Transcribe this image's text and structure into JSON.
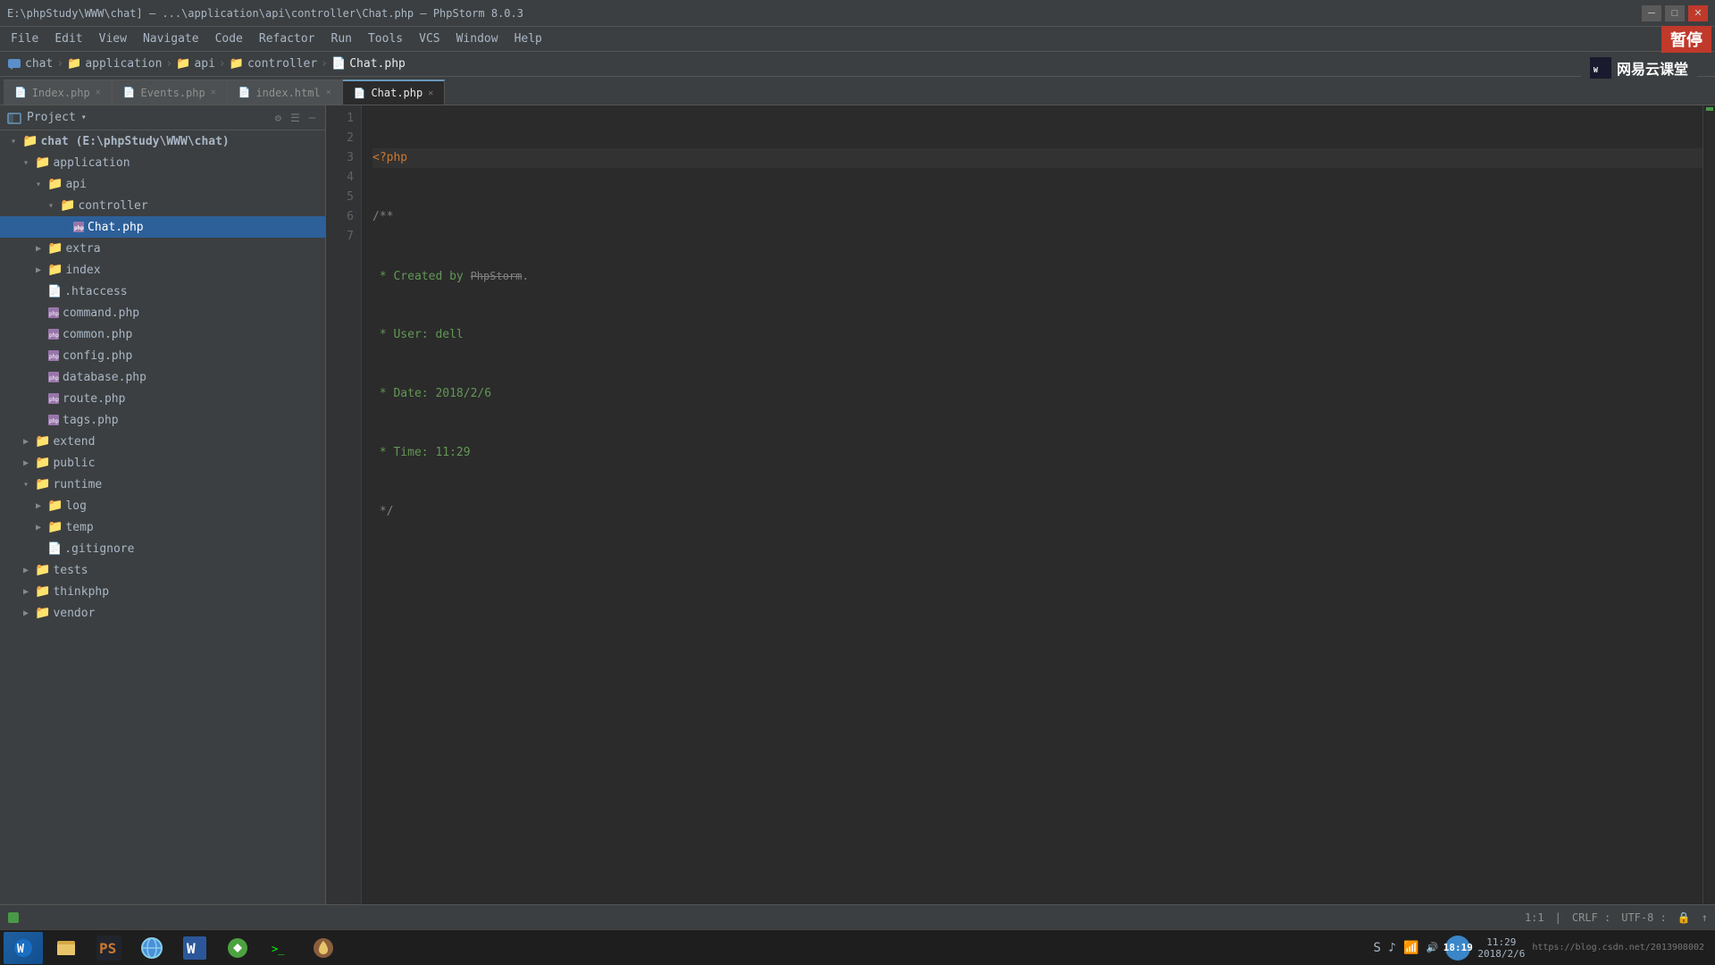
{
  "window": {
    "title": "E:\\phpStudy\\WWW\\chat] – ...\\application\\api\\controller\\Chat.php – PhpStorm 8.0.3",
    "minimize_label": "─",
    "maximize_label": "□",
    "close_label": "✕"
  },
  "menu": {
    "items": [
      "File",
      "Edit",
      "View",
      "Navigate",
      "Code",
      "Refactor",
      "Run",
      "Tools",
      "VCS",
      "Window",
      "Help"
    ]
  },
  "breadcrumb": {
    "items": [
      "chat",
      "application",
      "api",
      "controller",
      "Chat.php"
    ]
  },
  "watermark": {
    "text": "网易云课堂"
  },
  "tabs": [
    {
      "label": "Index.php",
      "active": false
    },
    {
      "label": "Events.php",
      "active": false
    },
    {
      "label": "index.html",
      "active": false
    },
    {
      "label": "Chat.php",
      "active": true
    }
  ],
  "project": {
    "label": "Project",
    "dropdown_icon": "▾"
  },
  "tree": [
    {
      "indent": 1,
      "type": "folder",
      "open": true,
      "label": "chat (E:\\phpStudy\\WWW\\chat)",
      "bold": true
    },
    {
      "indent": 2,
      "type": "folder",
      "open": true,
      "label": "application"
    },
    {
      "indent": 3,
      "type": "folder",
      "open": true,
      "label": "api"
    },
    {
      "indent": 4,
      "type": "folder",
      "open": true,
      "label": "controller"
    },
    {
      "indent": 5,
      "type": "file-php",
      "open": false,
      "label": "Chat.php",
      "selected": true
    },
    {
      "indent": 3,
      "type": "folder",
      "open": false,
      "label": "extra"
    },
    {
      "indent": 3,
      "type": "folder",
      "open": false,
      "label": "index"
    },
    {
      "indent": 3,
      "type": "file",
      "open": false,
      "label": ".htaccess"
    },
    {
      "indent": 3,
      "type": "file-php",
      "open": false,
      "label": "command.php"
    },
    {
      "indent": 3,
      "type": "file-php",
      "open": false,
      "label": "common.php"
    },
    {
      "indent": 3,
      "type": "file-php",
      "open": false,
      "label": "config.php"
    },
    {
      "indent": 3,
      "type": "file-php",
      "open": false,
      "label": "database.php"
    },
    {
      "indent": 3,
      "type": "file-php",
      "open": false,
      "label": "route.php"
    },
    {
      "indent": 3,
      "type": "file-php",
      "open": false,
      "label": "tags.php"
    },
    {
      "indent": 2,
      "type": "folder",
      "open": false,
      "label": "extend"
    },
    {
      "indent": 2,
      "type": "folder",
      "open": false,
      "label": "public"
    },
    {
      "indent": 2,
      "type": "folder",
      "open": true,
      "label": "runtime"
    },
    {
      "indent": 3,
      "type": "folder",
      "open": false,
      "label": "log"
    },
    {
      "indent": 3,
      "type": "folder",
      "open": false,
      "label": "temp"
    },
    {
      "indent": 3,
      "type": "file",
      "open": false,
      "label": ".gitignore"
    },
    {
      "indent": 2,
      "type": "folder",
      "open": false,
      "label": "tests"
    },
    {
      "indent": 2,
      "type": "folder",
      "open": false,
      "label": "thinkphp"
    },
    {
      "indent": 2,
      "type": "folder",
      "open": false,
      "label": "vendor"
    }
  ],
  "code": {
    "lines": [
      {
        "num": 1,
        "content": "<?php",
        "type": "php-tag"
      },
      {
        "num": 2,
        "content": "/**",
        "type": "comment"
      },
      {
        "num": 3,
        "content": " * Created by PhpStorm.",
        "type": "comment-text"
      },
      {
        "num": 4,
        "content": " * User: dell",
        "type": "comment-text"
      },
      {
        "num": 5,
        "content": " * Date: 2018/2/6",
        "type": "comment-text"
      },
      {
        "num": 6,
        "content": " * Time: 11:29",
        "type": "comment-text"
      },
      {
        "num": 7,
        "content": " */",
        "type": "comment"
      }
    ]
  },
  "status": {
    "position": "1:1",
    "line_ending": "CRLF",
    "encoding": "UTF-8",
    "icons": [
      "lock",
      "upload"
    ]
  },
  "taskbar": {
    "time": "11:29",
    "date": "2018/2/6",
    "badge": "18:19",
    "url": "https://blog.csdn.net/2013908002"
  }
}
